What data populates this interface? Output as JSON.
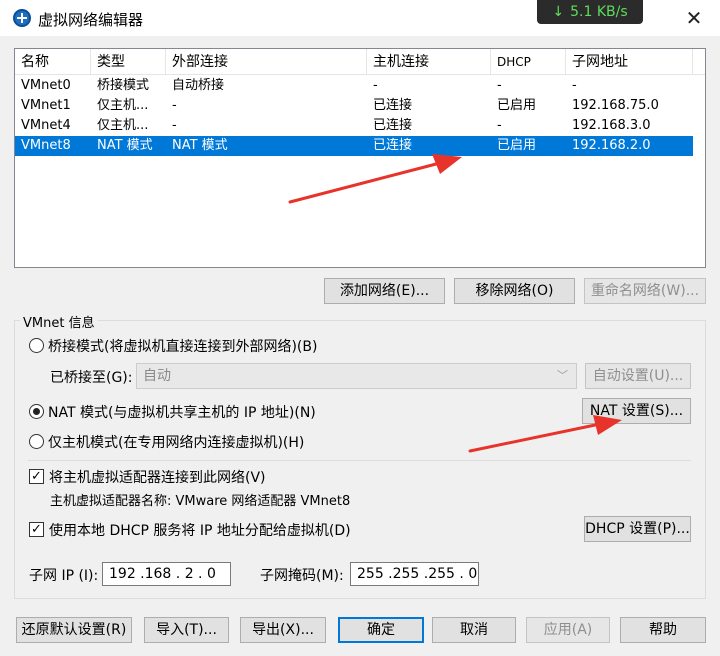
{
  "window": {
    "title": "虚拟网络编辑器",
    "speed": "5.1 KB/s",
    "close_glyph": "✕"
  },
  "table": {
    "headers": [
      "名称",
      "类型",
      "外部连接",
      "主机连接",
      "DHCP",
      "子网地址"
    ],
    "rows": [
      [
        "VMnet0",
        "桥接模式",
        "自动桥接",
        "-",
        "-",
        "-"
      ],
      [
        "VMnet1",
        "仅主机...",
        "-",
        "已连接",
        "已启用",
        "192.168.75.0"
      ],
      [
        "VMnet4",
        "仅主机...",
        "-",
        "已连接",
        "-",
        "192.168.3.0"
      ],
      [
        "VMnet8",
        "NAT 模式",
        "NAT 模式",
        "已连接",
        "已启用",
        "192.168.2.0"
      ]
    ],
    "selected_index": 3
  },
  "list_buttons": {
    "add": "添加网络(E)...",
    "remove": "移除网络(O)",
    "rename": "重命名网络(W)..."
  },
  "vmnet_info": {
    "title": "VMnet 信息",
    "bridge_mode": "桥接模式(将虚拟机直接连接到外部网络)(B)",
    "bridged_to_label": "已桥接至(G):",
    "bridged_to_value": "自动",
    "auto_settings": "自动设置(U)...",
    "nat_mode": "NAT 模式(与虚拟机共享主机的 IP 地址)(N)",
    "nat_settings": "NAT 设置(S)...",
    "host_only": "仅主机模式(在专用网络内连接虚拟机)(H)",
    "selected_mode": "nat",
    "connect_adapter": "将主机虚拟适配器连接到此网络(V)",
    "adapter_name": "主机虚拟适配器名称: VMware 网络适配器 VMnet8",
    "use_dhcp": "使用本地 DHCP 服务将 IP 地址分配给虚拟机(D)",
    "dhcp_settings": "DHCP 设置(P)...",
    "subnet_ip_label": "子网 IP (I):",
    "subnet_ip": "192 .168 . 2  . 0",
    "subnet_mask_label": "子网掩码(M):",
    "subnet_mask": "255 .255 .255 . 0"
  },
  "footer": {
    "restore": "还原默认设置(R)",
    "import": "导入(T)...",
    "export": "导出(X)...",
    "ok": "确定",
    "cancel": "取消",
    "apply": "应用(A)",
    "help": "帮助"
  },
  "colors": {
    "selection": "#0078d7",
    "annotation_arrow": "#e8332a",
    "speed_text": "#5ddc5d"
  }
}
